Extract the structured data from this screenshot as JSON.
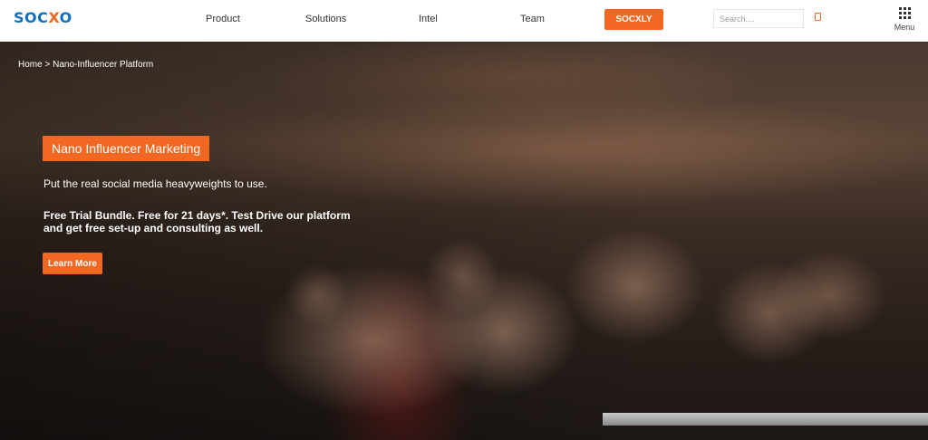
{
  "nav": {
    "logo_left": "SOC",
    "logo_x": "X",
    "logo_right": "O",
    "links": [
      "Product",
      "Solutions",
      "Intel",
      "Team"
    ],
    "cta_label": "SOCXLY",
    "search_placeholder": "Search....",
    "menu_label": "Menu"
  },
  "hero": {
    "breadcrumb_home": "Home",
    "breadcrumb_sep": ">",
    "breadcrumb_current": "Nano-Influencer Platform",
    "tag": "Nano Influencer Marketing",
    "subtitle": "Put the real social media heavyweights to use.",
    "offer_line1": "Free Trial Bundle. Free for 21 days*. Test Drive our platform",
    "offer_line2": "and get free set-up and consulting as well.",
    "cta_label": "Learn More"
  },
  "colors": {
    "accent": "#f26722",
    "brand_blue": "#0e6fbf"
  }
}
